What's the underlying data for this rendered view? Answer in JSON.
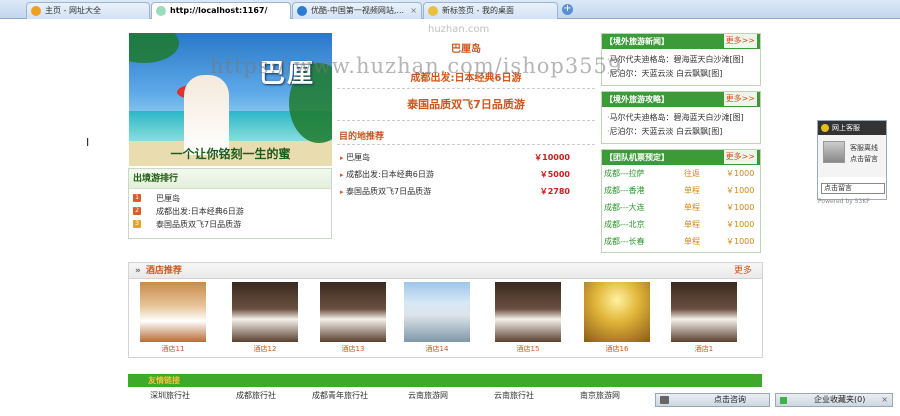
{
  "browser": {
    "tabs": [
      {
        "label": "主页 - 网址大全",
        "active": false
      },
      {
        "label": "http://localhost:1167/",
        "active": true
      },
      {
        "label": "优酷-中国第一视频网站,...",
        "active": false
      },
      {
        "label": "新标签页 - 我的桌面",
        "active": false
      }
    ],
    "close_glyph": "×",
    "new_tab_glyph": "+"
  },
  "watermark": {
    "url_text": "https://www.huzhan.com/ishop3559",
    "domain_text": "huzhan.com"
  },
  "promo": {
    "title": "巴厘",
    "slogan": "一个让你铭刻一生的蜜"
  },
  "middle": {
    "featured": [
      "巴厘岛",
      "成都出发:日本经典6日游",
      "泰国品质双飞7日品质游"
    ],
    "dest_heading": "目的地推荐",
    "destinations": [
      {
        "name": "巴厘岛",
        "price": "￥10000"
      },
      {
        "name": "成都出发:日本经典6日游",
        "price": "￥5000"
      },
      {
        "name": "泰国品质双飞7日品质游",
        "price": "￥2780"
      }
    ]
  },
  "ranking": {
    "heading": "出境游排行",
    "items": [
      {
        "num": "1",
        "label": "巴厘岛"
      },
      {
        "num": "2",
        "label": "成都出发:日本经典6日游"
      },
      {
        "num": "3",
        "label": "泰国品质双飞7日品质游"
      }
    ]
  },
  "news": {
    "heading": "【境外旅游新闻】",
    "more": "更多>>",
    "items": [
      {
        "prefix": "·",
        "text": "马尔代夫迪格岛：碧海蓝天白沙滩[图]"
      },
      {
        "prefix": "·",
        "text": "尼泊尔：天蓝云淡  白云飘飘[图]"
      }
    ]
  },
  "guides": {
    "heading": "【境外旅游攻略】",
    "more": "更多>>",
    "items": [
      {
        "prefix": "·",
        "text": "马尔代夫迪格岛：碧海蓝天白沙滩[图]"
      },
      {
        "prefix": "·",
        "text": "尼泊尔：天蓝云淡  白云飘飘[图]"
      }
    ]
  },
  "team": {
    "heading": "【团队机票预定】",
    "more": "更多>>",
    "routes": [
      {
        "route": "成都---拉萨",
        "type": "往返",
        "price": "￥1000"
      },
      {
        "route": "成都---香港",
        "type": "单程",
        "price": "￥1000"
      },
      {
        "route": "成都---大连",
        "type": "单程",
        "price": "￥1000"
      },
      {
        "route": "成都---北京",
        "type": "单程",
        "price": "￥1000"
      },
      {
        "route": "成都---长春",
        "type": "单程",
        "price": "￥1000"
      }
    ]
  },
  "hotels": {
    "heading": "酒店推荐",
    "arrow": "»",
    "more": "更多",
    "items": [
      {
        "label": "酒店11",
        "palette": "bedroom-warm"
      },
      {
        "label": "酒店12",
        "palette": "bedroom-dark"
      },
      {
        "label": "酒店13",
        "palette": "bedroom-dark"
      },
      {
        "label": "酒店14",
        "palette": "building"
      },
      {
        "label": "酒店15",
        "palette": "bedroom-dark"
      },
      {
        "label": "酒店16",
        "palette": "lobby-gold"
      },
      {
        "label": "酒店1",
        "palette": "bedroom-dark"
      }
    ]
  },
  "footer": {
    "bar_text": "友情链接",
    "links": [
      "深圳旅行社",
      "成都旅行社",
      "成都青年旅行社",
      "云南旅游网",
      "云南旅行社",
      "南京旅游网"
    ]
  },
  "qq_widget": {
    "heading": "网上客服",
    "line1": "客服离线",
    "line2": "点击留言",
    "button": "点击留言",
    "powered": "Powered by 53KF"
  },
  "chat_bars": {
    "consult": "点击咨询",
    "favorites": "企业收藏夹(0)",
    "close_glyph": "×"
  },
  "colors": {
    "accent_orange": "#d2561c",
    "green_header": "#3c9a38",
    "price_red": "#d01c1c",
    "footer_green": "#3fa92c"
  }
}
